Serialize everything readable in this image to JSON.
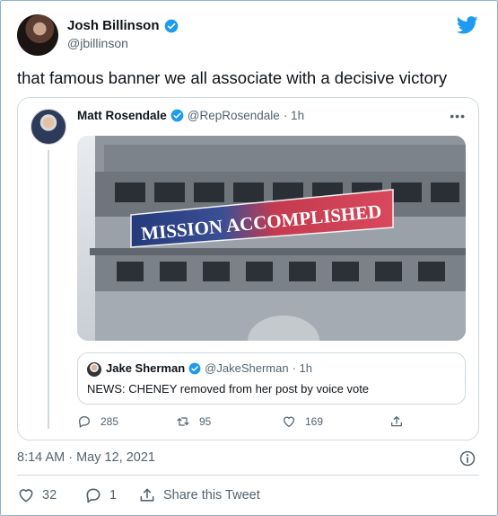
{
  "author": {
    "name": "Josh Billinson",
    "handle": "@jbillinson",
    "verified": true
  },
  "tweet": {
    "text": "that famous banner we all associate with a decisive victory",
    "timestamp": "8:14 AM · May 12, 2021"
  },
  "quoted_tweet": {
    "name": "Matt Rosendale",
    "handle": "@RepRosendale",
    "time": "· 1h",
    "verified": true,
    "image_banner_text": "MISSION ACCOMPLISHED",
    "inner_quote": {
      "name": "Jake Sherman",
      "handle": "@JakeSherman",
      "time": "· 1h",
      "verified": true,
      "text": "NEWS: CHENEY removed from her post by voice vote"
    },
    "actions": {
      "replies": "285",
      "retweets": "95",
      "likes": "169"
    }
  },
  "footer": {
    "likes": "32",
    "replies": "1",
    "share_label": "Share this Tweet"
  },
  "colors": {
    "twitter_blue": "#1d9bf0",
    "text_primary": "#0f1419",
    "text_secondary": "#536471",
    "border": "#cfd9de"
  },
  "icons": {
    "brand": "twitter-bird-icon",
    "badge": "verified-badge-icon",
    "more": "more-dots-icon",
    "reply": "reply-icon",
    "retweet": "retweet-icon",
    "like": "heart-icon",
    "share": "share-icon",
    "info": "info-icon"
  }
}
